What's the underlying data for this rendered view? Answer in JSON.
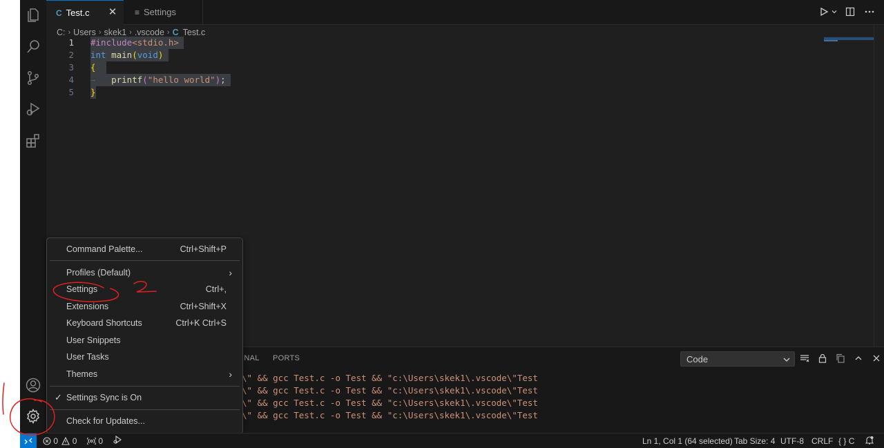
{
  "tabs": [
    {
      "icon": "C",
      "label": "Test.c",
      "close": "✕"
    },
    {
      "icon": "≡",
      "label": "Settings"
    }
  ],
  "breadcrumb": {
    "parts": [
      "C:",
      "Users",
      "skek1",
      ".vscode"
    ],
    "file_icon": "C",
    "file": "Test.c"
  },
  "code": {
    "line_numbers": [
      "1",
      "2",
      "3",
      "4",
      "5"
    ],
    "l1": {
      "pre": "#include",
      "inc": "<stdio.h>"
    },
    "l2": {
      "type": "int",
      "fn": "main",
      "open": "(",
      "arg": "void",
      "close": ")"
    },
    "l3": {
      "brace": "{"
    },
    "l4": {
      "fn": "printf",
      "open": "(",
      "str": "\"hello world\"",
      "close": ")",
      "semi": ";"
    },
    "l5": {
      "brace": "}"
    }
  },
  "panel": {
    "tabs": [
      "INAL",
      "PORTS"
    ],
    "select_value": "Code",
    "terminal_lines": [
      "\\\" && gcc Test.c -o Test && \"c:\\Users\\skek1\\.vscode\\\"Test",
      "\\\" && gcc Test.c -o Test && \"c:\\Users\\skek1\\.vscode\\\"Test",
      "\\\" && gcc Test.c -o Test && \"c:\\Users\\skek1\\.vscode\\\"Test",
      "\\\" && gcc Test.c -o Test && \"c:\\Users\\skek1\\.vscode\\\"Test"
    ]
  },
  "menu": {
    "command_palette": {
      "label": "Command Palette...",
      "shortcut": "Ctrl+Shift+P"
    },
    "profiles": {
      "label": "Profiles (Default)"
    },
    "settings": {
      "label": "Settings",
      "shortcut": "Ctrl+,"
    },
    "extensions": {
      "label": "Extensions",
      "shortcut": "Ctrl+Shift+X"
    },
    "keyboard_shortcuts": {
      "label": "Keyboard Shortcuts",
      "shortcut": "Ctrl+K Ctrl+S"
    },
    "user_snippets": {
      "label": "User Snippets"
    },
    "user_tasks": {
      "label": "User Tasks"
    },
    "themes": {
      "label": "Themes"
    },
    "settings_sync": {
      "label": "Settings Sync is On",
      "check": "✓"
    },
    "check_updates": {
      "label": "Check for Updates..."
    }
  },
  "statusbar": {
    "errors": "0",
    "warnings": "0",
    "ports": "0",
    "position": "Ln 1, Col 1 (64 selected)",
    "tab_size": "Tab Size: 4",
    "encoding": "UTF-8",
    "eol": "CRLF",
    "language_braces": "{ }",
    "language": "C"
  },
  "annotation": {
    "step2": "2",
    "color": "#e02020"
  },
  "colors": {
    "accent": "#0078d4",
    "editor_bg": "#1f1f1f",
    "sidebar_bg": "#181818"
  }
}
